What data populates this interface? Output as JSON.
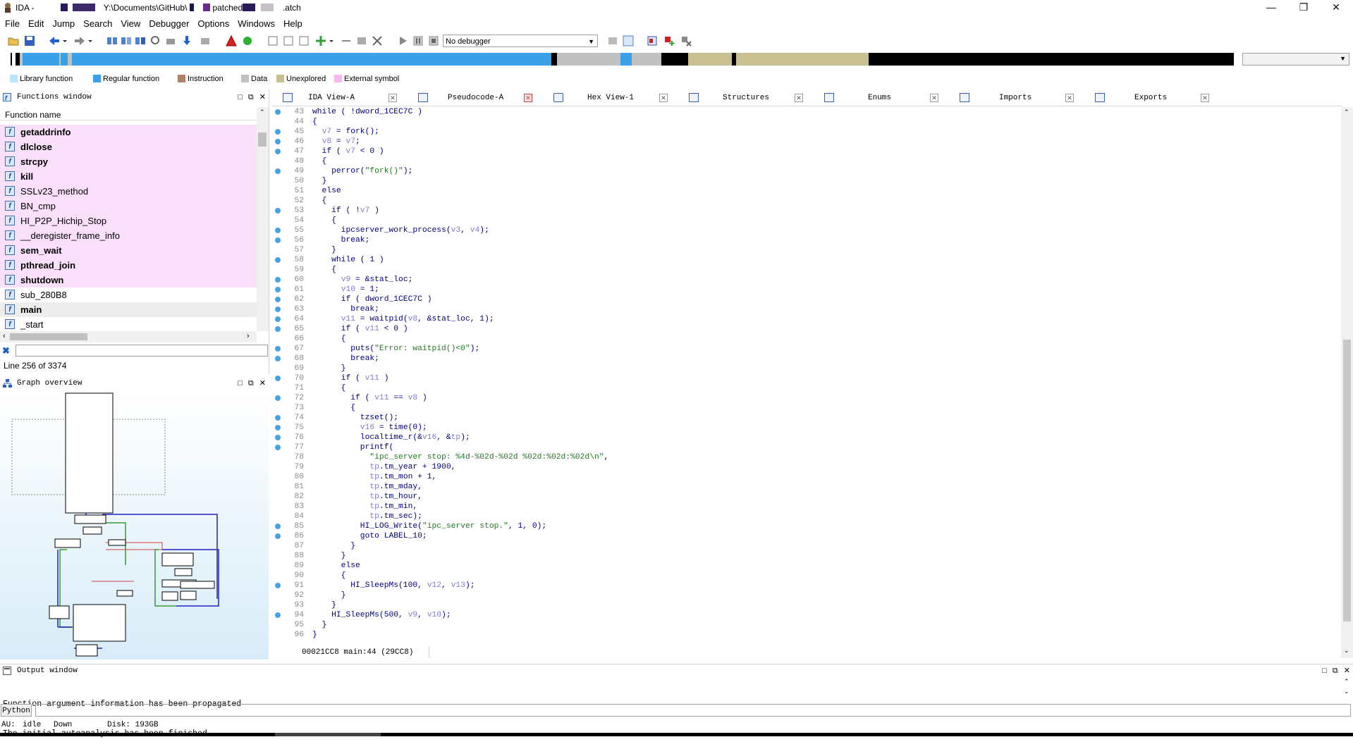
{
  "window": {
    "title_prefix": "IDA - ",
    "title_path": "Y:\\Documents\\GitHub\\",
    "title_file": "patched",
    "title_suffix": ".atch"
  },
  "menu": [
    "File",
    "Edit",
    "Jump",
    "Search",
    "View",
    "Debugger",
    "Options",
    "Windows",
    "Help"
  ],
  "toolbar": {
    "debugger_value": "No debugger"
  },
  "legend": [
    {
      "label": "Library function",
      "color": "#b8e6ff"
    },
    {
      "label": "Regular function",
      "color": "#3aa0e8"
    },
    {
      "label": "Instruction",
      "color": "#b0826a"
    },
    {
      "label": "Data",
      "color": "#c0c0c0"
    },
    {
      "label": "Unexplored",
      "color": "#c8c090"
    },
    {
      "label": "External symbol",
      "color": "#f8b8f0"
    }
  ],
  "functions_window": {
    "title": "Functions window",
    "column": "Function name",
    "items": [
      {
        "name": "getaddrinfo",
        "bold": true,
        "pink": true
      },
      {
        "name": "dlclose",
        "bold": true,
        "pink": true
      },
      {
        "name": "strcpy",
        "bold": true,
        "pink": true
      },
      {
        "name": "kill",
        "bold": true,
        "pink": true
      },
      {
        "name": "SSLv23_method",
        "bold": false,
        "pink": true
      },
      {
        "name": "BN_cmp",
        "bold": false,
        "pink": true
      },
      {
        "name": "HI_P2P_Hichip_Stop",
        "bold": false,
        "pink": true
      },
      {
        "name": "__deregister_frame_info",
        "bold": false,
        "pink": true
      },
      {
        "name": "sem_wait",
        "bold": true,
        "pink": true
      },
      {
        "name": "pthread_join",
        "bold": true,
        "pink": true
      },
      {
        "name": "shutdown",
        "bold": true,
        "pink": true
      },
      {
        "name": "sub_280B8",
        "bold": false,
        "pink": false
      },
      {
        "name": "main",
        "bold": true,
        "pink": false,
        "selected": true
      },
      {
        "name": "_start",
        "bold": false,
        "pink": false
      }
    ],
    "line_info": "Line 256 of 3374"
  },
  "graph_overview": {
    "title": "Graph overview"
  },
  "tabs": [
    {
      "label": "IDA View-A",
      "active": false,
      "closeRed": false
    },
    {
      "label": "Pseudocode-A",
      "active": true,
      "closeRed": true
    },
    {
      "label": "Hex View-1",
      "active": false,
      "closeRed": false
    },
    {
      "label": "Structures",
      "active": false,
      "closeRed": false
    },
    {
      "label": "Enums",
      "active": false,
      "closeRed": false
    },
    {
      "label": "Imports",
      "active": false,
      "closeRed": false
    },
    {
      "label": "Exports",
      "active": false,
      "closeRed": false
    }
  ],
  "code": [
    {
      "n": "43",
      "dot": true,
      "t": "while ( !dword_1CEC7C )"
    },
    {
      "n": "44",
      "dot": false,
      "t": "{"
    },
    {
      "n": "45",
      "dot": true,
      "t": "  v7 = fork();"
    },
    {
      "n": "46",
      "dot": true,
      "t": "  v8 = v7;"
    },
    {
      "n": "47",
      "dot": true,
      "t": "  if ( v7 < 0 )"
    },
    {
      "n": "48",
      "dot": false,
      "t": "  {"
    },
    {
      "n": "49",
      "dot": true,
      "t": "    perror(\"fork()\");"
    },
    {
      "n": "50",
      "dot": false,
      "t": "  }"
    },
    {
      "n": "51",
      "dot": false,
      "t": "  else"
    },
    {
      "n": "52",
      "dot": false,
      "t": "  {"
    },
    {
      "n": "53",
      "dot": true,
      "t": "    if ( !v7 )"
    },
    {
      "n": "54",
      "dot": false,
      "t": "    {"
    },
    {
      "n": "55",
      "dot": true,
      "t": "      ipcserver_work_process(v3, v4);"
    },
    {
      "n": "56",
      "dot": true,
      "t": "      break;"
    },
    {
      "n": "57",
      "dot": false,
      "t": "    }"
    },
    {
      "n": "58",
      "dot": true,
      "t": "    while ( 1 )"
    },
    {
      "n": "59",
      "dot": false,
      "t": "    {"
    },
    {
      "n": "60",
      "dot": true,
      "t": "      v9 = &stat_loc;"
    },
    {
      "n": "61",
      "dot": true,
      "t": "      v10 = 1;"
    },
    {
      "n": "62",
      "dot": true,
      "t": "      if ( dword_1CEC7C )"
    },
    {
      "n": "63",
      "dot": true,
      "t": "        break;"
    },
    {
      "n": "64",
      "dot": true,
      "t": "      v11 = waitpid(v8, &stat_loc, 1);"
    },
    {
      "n": "65",
      "dot": true,
      "t": "      if ( v11 < 0 )"
    },
    {
      "n": "66",
      "dot": false,
      "t": "      {"
    },
    {
      "n": "67",
      "dot": true,
      "t": "        puts(\"Error: waitpid()<0\");"
    },
    {
      "n": "68",
      "dot": true,
      "t": "        break;"
    },
    {
      "n": "69",
      "dot": false,
      "t": "      }"
    },
    {
      "n": "70",
      "dot": true,
      "t": "      if ( v11 )"
    },
    {
      "n": "71",
      "dot": false,
      "t": "      {"
    },
    {
      "n": "72",
      "dot": true,
      "t": "        if ( v11 == v8 )"
    },
    {
      "n": "73",
      "dot": false,
      "t": "        {"
    },
    {
      "n": "74",
      "dot": true,
      "t": "          tzset();"
    },
    {
      "n": "75",
      "dot": true,
      "t": "          v16 = time(0);"
    },
    {
      "n": "76",
      "dot": true,
      "t": "          localtime_r(&v16, &tp);"
    },
    {
      "n": "77",
      "dot": true,
      "t": "          printf("
    },
    {
      "n": "78",
      "dot": false,
      "t": "            \"ipc_server stop: %4d-%02d-%02d %02d:%02d:%02d\\n\","
    },
    {
      "n": "79",
      "dot": false,
      "t": "            tp.tm_year + 1900,"
    },
    {
      "n": "80",
      "dot": false,
      "t": "            tp.tm_mon + 1,"
    },
    {
      "n": "81",
      "dot": false,
      "t": "            tp.tm_mday,"
    },
    {
      "n": "82",
      "dot": false,
      "t": "            tp.tm_hour,"
    },
    {
      "n": "83",
      "dot": false,
      "t": "            tp.tm_min,"
    },
    {
      "n": "84",
      "dot": false,
      "t": "            tp.tm_sec);"
    },
    {
      "n": "85",
      "dot": true,
      "t": "          HI_LOG_Write(\"ipc_server stop.\", 1, 0);"
    },
    {
      "n": "86",
      "dot": true,
      "t": "          goto LABEL_10;"
    },
    {
      "n": "87",
      "dot": false,
      "t": "        }"
    },
    {
      "n": "88",
      "dot": false,
      "t": "      }"
    },
    {
      "n": "89",
      "dot": false,
      "t": "      else"
    },
    {
      "n": "90",
      "dot": false,
      "t": "      {"
    },
    {
      "n": "91",
      "dot": true,
      "t": "        HI_SleepMs(100, v12, v13);"
    },
    {
      "n": "92",
      "dot": false,
      "t": "      }"
    },
    {
      "n": "93",
      "dot": false,
      "t": "    }"
    },
    {
      "n": "94",
      "dot": true,
      "t": "    HI_SleepMs(500, v9, v10);"
    },
    {
      "n": "95",
      "dot": false,
      "t": "  }"
    },
    {
      "n": "96",
      "dot": false,
      "t": "}"
    }
  ],
  "code_status": "00021CC8 main:44 (29CC8)",
  "output_window": {
    "title": "Output window",
    "lines": [
      "Function argument information has been propagated",
      "The initial autoanalysis has been finished."
    ],
    "python_label": "Python"
  },
  "statusbar": {
    "au_label": "AU:",
    "au_value": "idle",
    "direction": "Down",
    "disk": "Disk: 193GB"
  }
}
